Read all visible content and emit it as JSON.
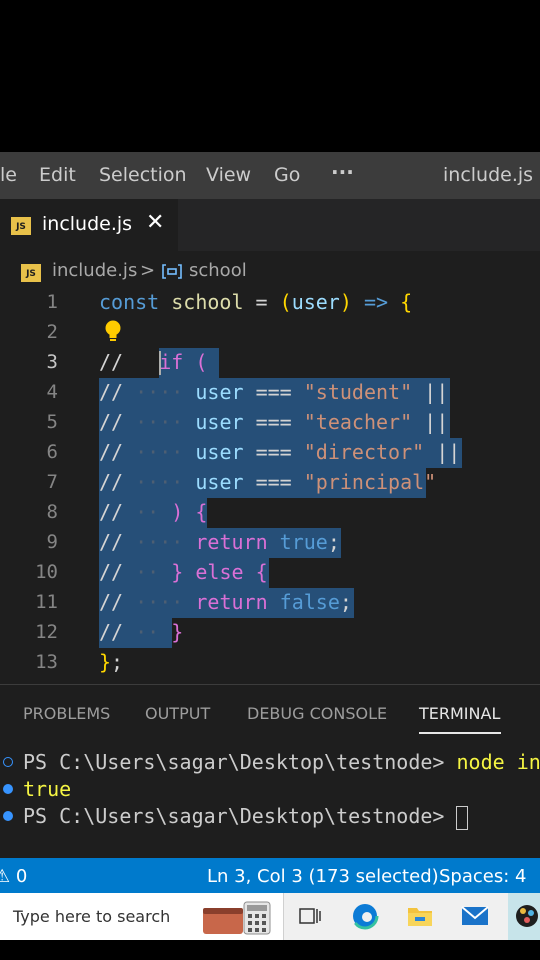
{
  "menubar": {
    "items": [
      "le",
      "Edit",
      "Selection",
      "View",
      "Go"
    ],
    "more": "···",
    "window_title": "include.js - t"
  },
  "tab": {
    "badge": "JS",
    "title": "include.js",
    "close": "✕"
  },
  "breadcrumb": {
    "file": "include.js",
    "separator": ">",
    "symbol": "school"
  },
  "editor": {
    "line_numbers": [
      "1",
      "2",
      "3",
      "4",
      "5",
      "6",
      "7",
      "8",
      "9",
      "10",
      "11",
      "12",
      "13"
    ],
    "current_line": "3"
  },
  "panel": {
    "tabs": [
      "PROBLEMS",
      "OUTPUT",
      "DEBUG CONSOLE",
      "TERMINAL"
    ],
    "active_tab": "TERMINAL",
    "terminal": {
      "prompt1": "PS C:\\Users\\sagar\\Desktop\\testnode> ",
      "command": "node incl",
      "output": "true",
      "prompt2": "PS C:\\Users\\sagar\\Desktop\\testnode> "
    }
  },
  "statusbar": {
    "problems": "⚠ 0",
    "position": "Ln 3, Col 3 (173 selected)",
    "spaces": "Spaces: 4"
  },
  "taskbar": {
    "search_placeholder": "Type here to search"
  },
  "colors": {
    "accent": "#007acc",
    "selection": "#264f78",
    "editor_bg": "#1e1e1e"
  }
}
